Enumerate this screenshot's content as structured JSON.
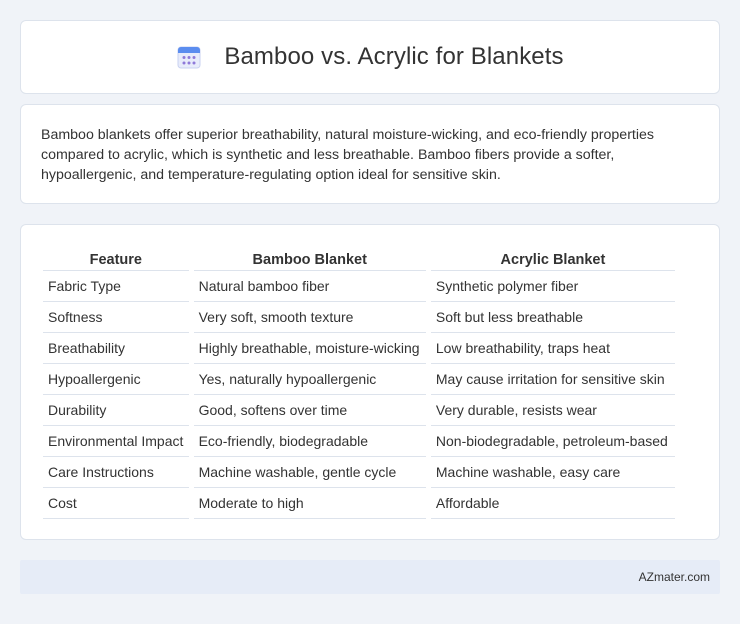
{
  "header": {
    "title": "Bamboo vs. Acrylic for Blankets",
    "icon": "calendar-icon"
  },
  "intro": {
    "text": "Bamboo blankets offer superior breathability, natural moisture-wicking, and eco-friendly properties compared to acrylic, which is synthetic and less breathable. Bamboo fibers provide a softer, hypoallergenic, and temperature-regulating option ideal for sensitive skin."
  },
  "table": {
    "headers": [
      "Feature",
      "Bamboo Blanket",
      "Acrylic Blanket"
    ],
    "rows": [
      [
        "Fabric Type",
        "Natural bamboo fiber",
        "Synthetic polymer fiber"
      ],
      [
        "Softness",
        "Very soft, smooth texture",
        "Soft but less breathable"
      ],
      [
        "Breathability",
        "Highly breathable, moisture-wicking",
        "Low breathability, traps heat"
      ],
      [
        "Hypoallergenic",
        "Yes, naturally hypoallergenic",
        "May cause irritation for sensitive skin"
      ],
      [
        "Durability",
        "Good, softens over time",
        "Very durable, resists wear"
      ],
      [
        "Environmental Impact",
        "Eco-friendly, biodegradable",
        "Non-biodegradable, petroleum-based"
      ],
      [
        "Care Instructions",
        "Machine washable, gentle cycle",
        "Machine washable, easy care"
      ],
      [
        "Cost",
        "Moderate to high",
        "Affordable"
      ]
    ]
  },
  "footer": {
    "brand": "AZmater.com"
  },
  "colors": {
    "background": "#f0f3f8",
    "card": "#ffffff",
    "border": "#dde3ec",
    "footer": "#e6ecf7",
    "icon_accent": "#5b8def"
  }
}
